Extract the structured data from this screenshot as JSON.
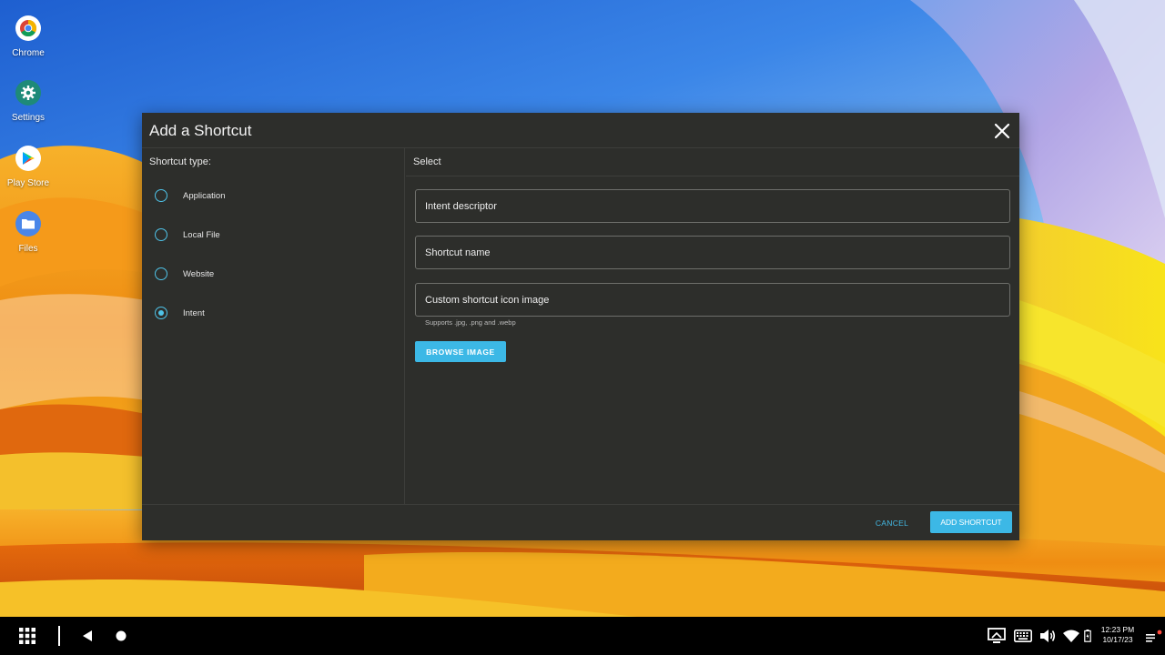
{
  "desktop": {
    "icons": [
      {
        "label": "Chrome",
        "icon": "chrome-icon"
      },
      {
        "label": "Settings",
        "icon": "gear-icon"
      },
      {
        "label": "Play Store",
        "icon": "play-store-icon"
      },
      {
        "label": "Files",
        "icon": "folder-icon"
      }
    ]
  },
  "dialog": {
    "title": "Add a Shortcut",
    "close_icon": "close-icon",
    "shortcut_type_label": "Shortcut type:",
    "options": [
      {
        "label": "Application",
        "checked": false
      },
      {
        "label": "Local File",
        "checked": false
      },
      {
        "label": "Website",
        "checked": false
      },
      {
        "label": "Intent",
        "checked": true
      }
    ],
    "select_label": "Select",
    "fields": {
      "intent_descriptor": "Intent descriptor",
      "shortcut_name": "Shortcut name",
      "custom_icon": "Custom shortcut icon image"
    },
    "supports_hint": "Supports .jpg, .png and .webp",
    "browse_button": "BROWSE IMAGE",
    "cancel_button": "CANCEL",
    "add_button": "ADD SHORTCUT"
  },
  "taskbar": {
    "time": "12:23 PM",
    "date": "10/17/23",
    "icons": [
      "apps-grid-icon",
      "back-icon",
      "home-icon",
      "screen-cast-icon",
      "keyboard-icon",
      "volume-icon",
      "wifi-icon",
      "battery-icon",
      "notifications-icon"
    ]
  },
  "colors": {
    "accent": "#3cb8e6",
    "dialog_bg": "#2d2e2b",
    "taskbar_bg": "#000000"
  }
}
